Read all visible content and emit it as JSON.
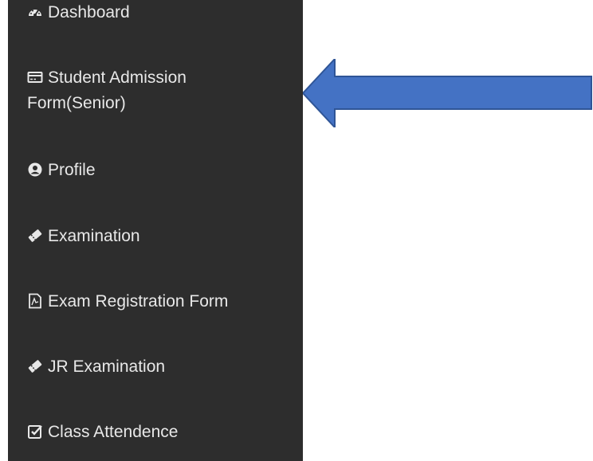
{
  "sidebar": {
    "background": "#2d2d2d",
    "items": [
      {
        "label": "Dashboard",
        "icon": "dashboard-icon"
      },
      {
        "label": "Student Admission Form(Senior)",
        "icon": "id-card-icon"
      },
      {
        "label": "Profile",
        "icon": "user-circle-icon"
      },
      {
        "label": "Examination",
        "icon": "ticket-icon"
      },
      {
        "label": "Exam Registration Form",
        "icon": "pdf-file-icon"
      },
      {
        "label": "JR Examination",
        "icon": "ticket-icon"
      },
      {
        "label": "Class Attendence",
        "icon": "check-square-icon"
      }
    ]
  },
  "annotation": {
    "arrow_color": "#4472c4",
    "arrow_points_to": "Student Admission Form(Senior)"
  }
}
